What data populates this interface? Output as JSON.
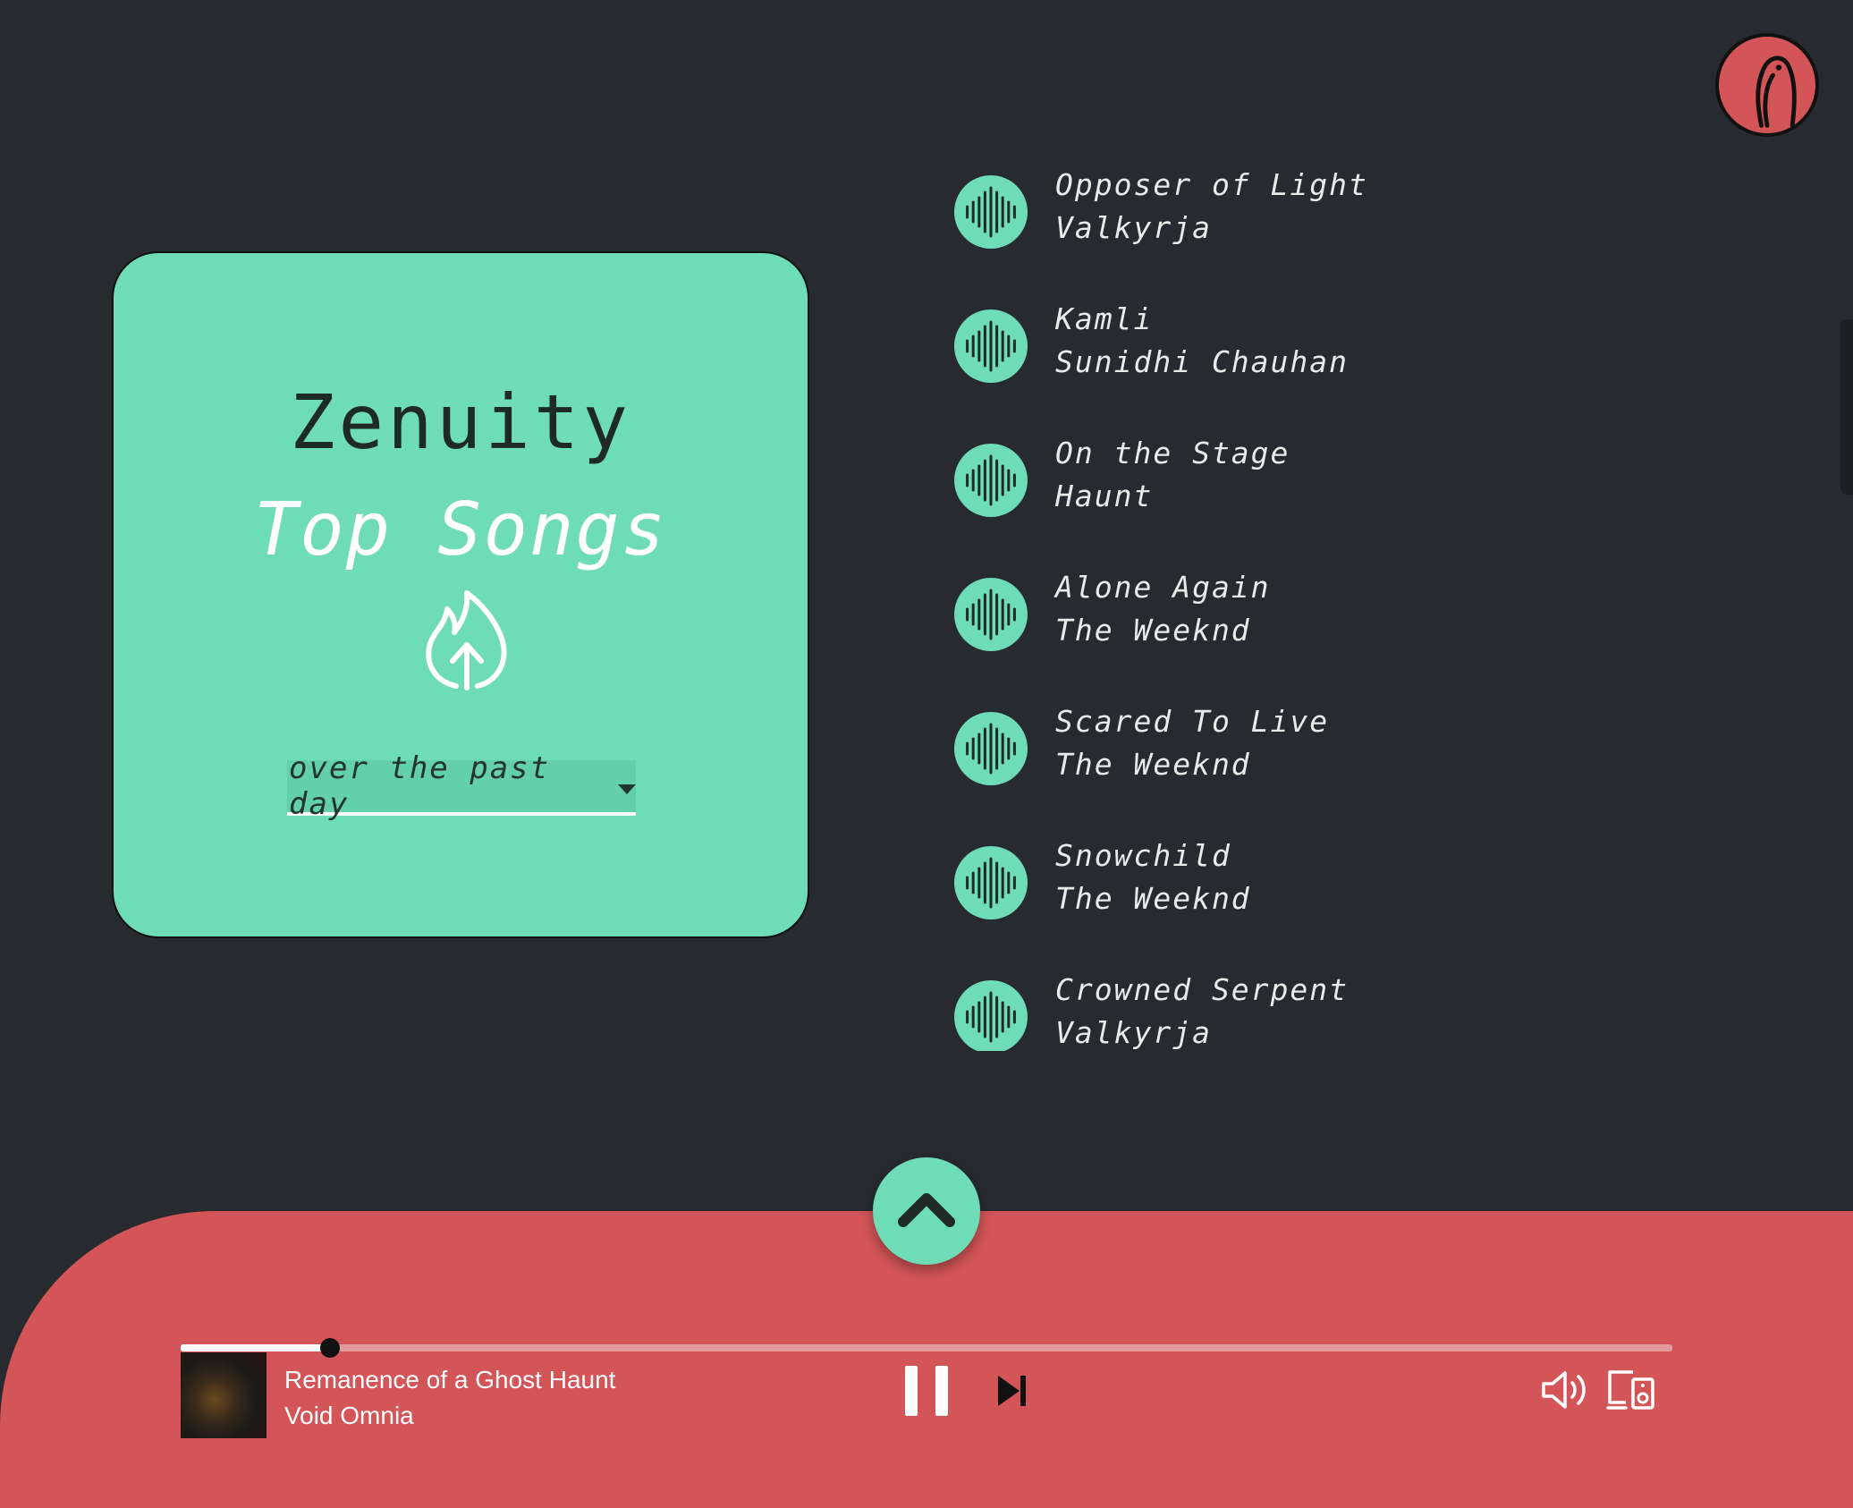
{
  "app": {
    "name": "Zenuity"
  },
  "hero": {
    "title": "Top Songs",
    "period_select": {
      "value": "over the past day"
    }
  },
  "songs": [
    {
      "title": "Opposer of Light",
      "artist": "Valkyrja"
    },
    {
      "title": "Kamli",
      "artist": "Sunidhi Chauhan"
    },
    {
      "title": "On the Stage",
      "artist": "Haunt"
    },
    {
      "title": "Alone Again",
      "artist": "The Weeknd"
    },
    {
      "title": "Scared To Live",
      "artist": "The Weeknd"
    },
    {
      "title": "Snowchild",
      "artist": "The Weeknd"
    },
    {
      "title": "Crowned Serpent",
      "artist": "Valkyrja"
    }
  ],
  "player": {
    "track_title": "Remanence of a Ghost Haunt",
    "track_artist": "Void Omnia",
    "progress": 0.1,
    "state": "playing"
  },
  "icons": {
    "avatar": "bird-icon",
    "hero": "fire-arrow-icon",
    "song": "sound-wave-icon",
    "expand": "chevron-up-icon",
    "pause": "pause-icon",
    "next": "skip-next-icon",
    "volume": "volume-icon",
    "devices": "devices-icon"
  },
  "colors": {
    "background": "#272a2f",
    "accent_green": "#6fdcb8",
    "player_red": "#d35557",
    "text_light": "#e8ece9"
  }
}
